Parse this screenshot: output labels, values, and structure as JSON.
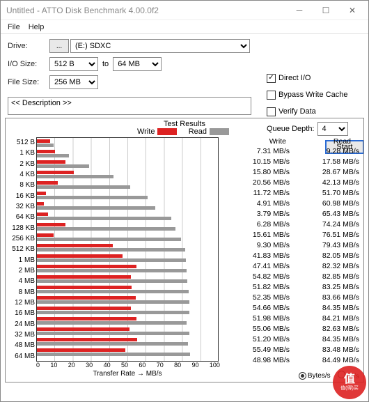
{
  "window": {
    "title": "Untitled - ATTO Disk Benchmark 4.00.0f2"
  },
  "menu": {
    "file": "File",
    "help": "Help"
  },
  "form": {
    "drive_label": "Drive:",
    "drive_btn": "...",
    "drive_value": "(E:) SDXC",
    "iosize_label": "I/O Size:",
    "iosize_from": "512 B",
    "to": "to",
    "iosize_to": "64 MB",
    "filesize_label": "File Size:",
    "filesize_value": "256 MB",
    "direct_io": "Direct I/O",
    "bypass": "Bypass Write Cache",
    "verify": "Verify Data",
    "queue_label": "Queue Depth:",
    "queue_value": "4",
    "start": "Start",
    "description": "<< Description >>"
  },
  "radios": {
    "bytes": "Bytes/s",
    "io": "IO/s"
  },
  "chart_data": {
    "type": "bar",
    "title": "Test Results",
    "legend": {
      "write": "Write",
      "read": "Read"
    },
    "xlabel": "Transfer Rate → MB/s",
    "xlim": [
      0,
      100
    ],
    "xticks": [
      0,
      10,
      20,
      30,
      40,
      50,
      60,
      70,
      80,
      90,
      100
    ],
    "unit": "MB/s",
    "categories": [
      "512 B",
      "1 KB",
      "2 KB",
      "4 KB",
      "8 KB",
      "16 KB",
      "32 KB",
      "64 KB",
      "128 KB",
      "256 KB",
      "512 KB",
      "1 MB",
      "2 MB",
      "4 MB",
      "8 MB",
      "12 MB",
      "16 MB",
      "24 MB",
      "32 MB",
      "48 MB",
      "64 MB"
    ],
    "series": [
      {
        "name": "Write",
        "values": [
          7.31,
          10.15,
          15.8,
          20.56,
          11.72,
          4.91,
          3.79,
          6.28,
          15.61,
          9.3,
          41.83,
          47.41,
          54.82,
          51.82,
          52.35,
          54.66,
          51.98,
          55.06,
          51.2,
          55.49,
          48.98
        ]
      },
      {
        "name": "Read",
        "values": [
          9.28,
          17.58,
          28.67,
          42.13,
          51.7,
          60.98,
          65.43,
          74.24,
          76.51,
          79.43,
          82.05,
          82.32,
          82.85,
          83.25,
          83.66,
          84.35,
          84.21,
          82.63,
          84.35,
          83.48,
          84.49
        ]
      }
    ]
  },
  "watermark": "值(得)买"
}
